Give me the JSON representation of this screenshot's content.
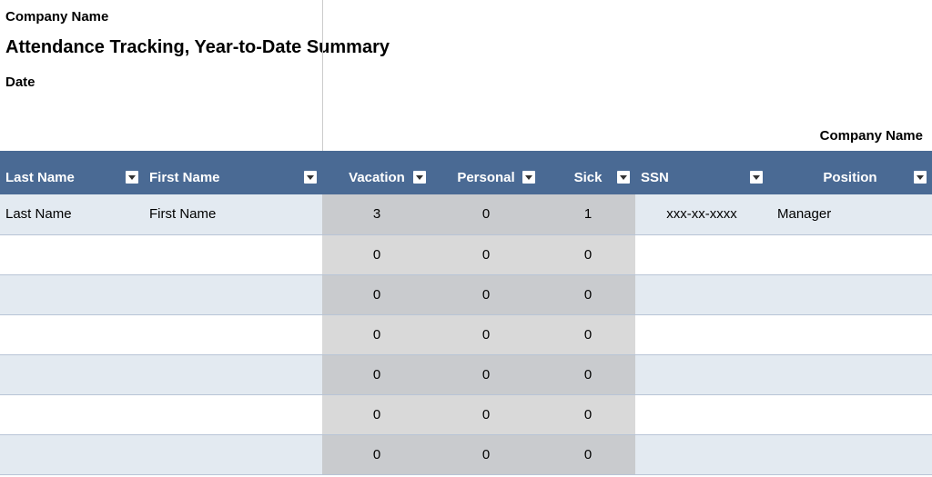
{
  "header": {
    "company_top": "Company Name",
    "title": "Attendance Tracking, Year-to-Date Summary",
    "date_label": "Date",
    "company_right": "Company Name"
  },
  "columns": {
    "last_name": "Last Name",
    "first_name": "First Name",
    "vacation": "Vacation",
    "personal": "Personal",
    "sick": "Sick",
    "ssn": "SSN",
    "position": "Position"
  },
  "rows": [
    {
      "last_name": "Last Name",
      "first_name": "First Name",
      "vacation": "3",
      "personal": "0",
      "sick": "1",
      "ssn": "xxx-xx-xxxx",
      "position": "Manager"
    },
    {
      "last_name": "",
      "first_name": "",
      "vacation": "0",
      "personal": "0",
      "sick": "0",
      "ssn": "",
      "position": ""
    },
    {
      "last_name": "",
      "first_name": "",
      "vacation": "0",
      "personal": "0",
      "sick": "0",
      "ssn": "",
      "position": ""
    },
    {
      "last_name": "",
      "first_name": "",
      "vacation": "0",
      "personal": "0",
      "sick": "0",
      "ssn": "",
      "position": ""
    },
    {
      "last_name": "",
      "first_name": "",
      "vacation": "0",
      "personal": "0",
      "sick": "0",
      "ssn": "",
      "position": ""
    },
    {
      "last_name": "",
      "first_name": "",
      "vacation": "0",
      "personal": "0",
      "sick": "0",
      "ssn": "",
      "position": ""
    },
    {
      "last_name": "",
      "first_name": "",
      "vacation": "0",
      "personal": "0",
      "sick": "0",
      "ssn": "",
      "position": ""
    }
  ]
}
